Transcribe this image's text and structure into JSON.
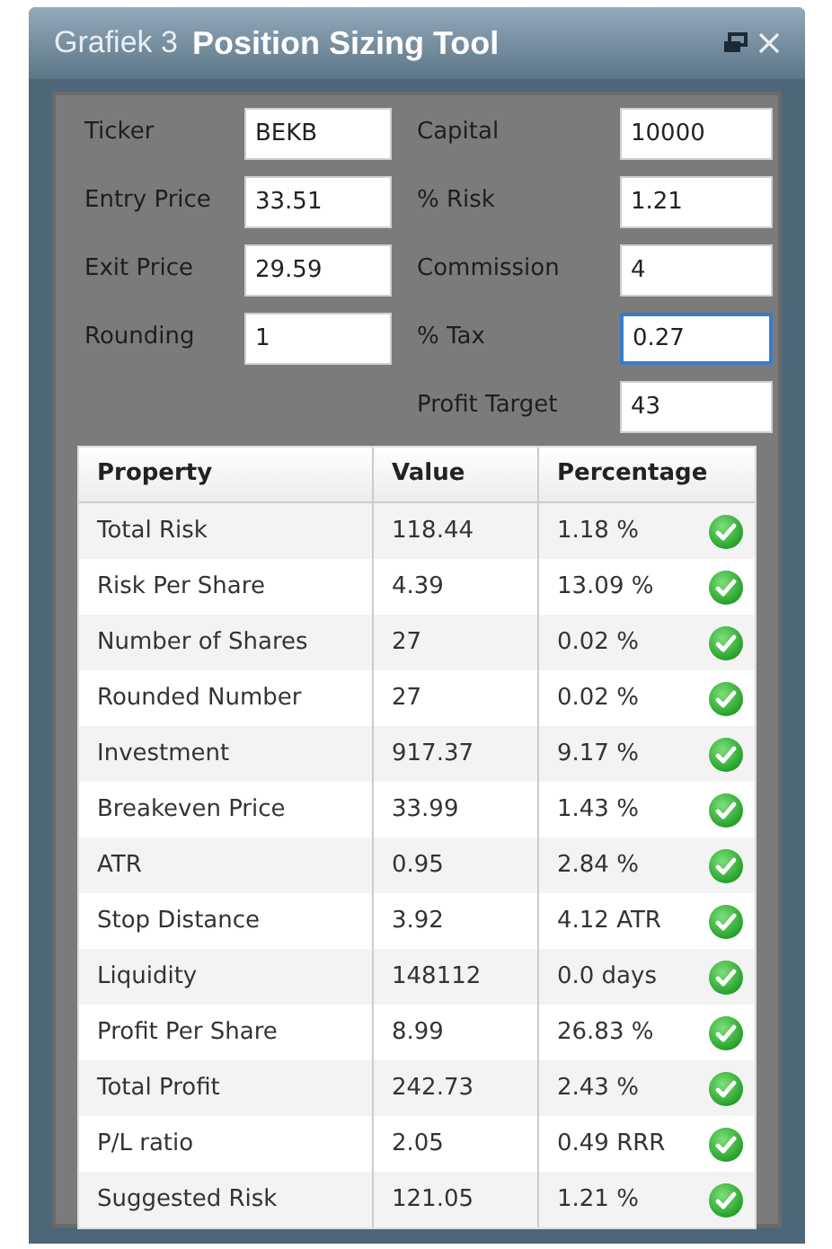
{
  "window": {
    "caption": "Grafiek 3",
    "title": "Position Sizing Tool"
  },
  "fields": [
    {
      "label": "Ticker",
      "value": "BEKB",
      "focused": false
    },
    {
      "label": "Capital",
      "value": "10000",
      "focused": false
    },
    {
      "label": "Entry Price",
      "value": "33.51",
      "focused": false
    },
    {
      "label": "% Risk",
      "value": "1.21",
      "focused": false
    },
    {
      "label": "Exit Price",
      "value": "29.59",
      "focused": false
    },
    {
      "label": "Commission",
      "value": "4",
      "focused": false
    },
    {
      "label": "Rounding",
      "value": "1",
      "focused": false
    },
    {
      "label": "% Tax",
      "value": "0.27",
      "focused": true
    },
    {
      "label": "Profit Target",
      "value": "43",
      "focused": false
    }
  ],
  "table": {
    "columns": [
      "Property",
      "Value",
      "Percentage"
    ],
    "rows": [
      {
        "property": "Total Risk",
        "value": "118.44",
        "percentage": "1.18 %",
        "ok": true
      },
      {
        "property": "Risk Per Share",
        "value": "4.39",
        "percentage": "13.09 %",
        "ok": true
      },
      {
        "property": "Number of Shares",
        "value": "27",
        "percentage": "0.02 %",
        "ok": true
      },
      {
        "property": "Rounded Number",
        "value": "27",
        "percentage": "0.02 %",
        "ok": true
      },
      {
        "property": "Investment",
        "value": "917.37",
        "percentage": "9.17 %",
        "ok": true
      },
      {
        "property": "Breakeven Price",
        "value": "33.99",
        "percentage": "1.43 %",
        "ok": true
      },
      {
        "property": "ATR",
        "value": "0.95",
        "percentage": "2.84 %",
        "ok": true
      },
      {
        "property": "Stop Distance",
        "value": "3.92",
        "percentage": "4.12 ATR",
        "ok": true
      },
      {
        "property": "Liquidity",
        "value": "148112",
        "percentage": "0.0 days",
        "ok": true
      },
      {
        "property": "Profit Per Share",
        "value": "8.99",
        "percentage": "26.83 %",
        "ok": true
      },
      {
        "property": "Total Profit",
        "value": "242.73",
        "percentage": "2.43 %",
        "ok": true
      },
      {
        "property": "P/L ratio",
        "value": "2.05",
        "percentage": "0.49 RRR",
        "ok": true
      },
      {
        "property": "Suggested Risk",
        "value": "121.05",
        "percentage": "1.21 %",
        "ok": true
      }
    ]
  }
}
